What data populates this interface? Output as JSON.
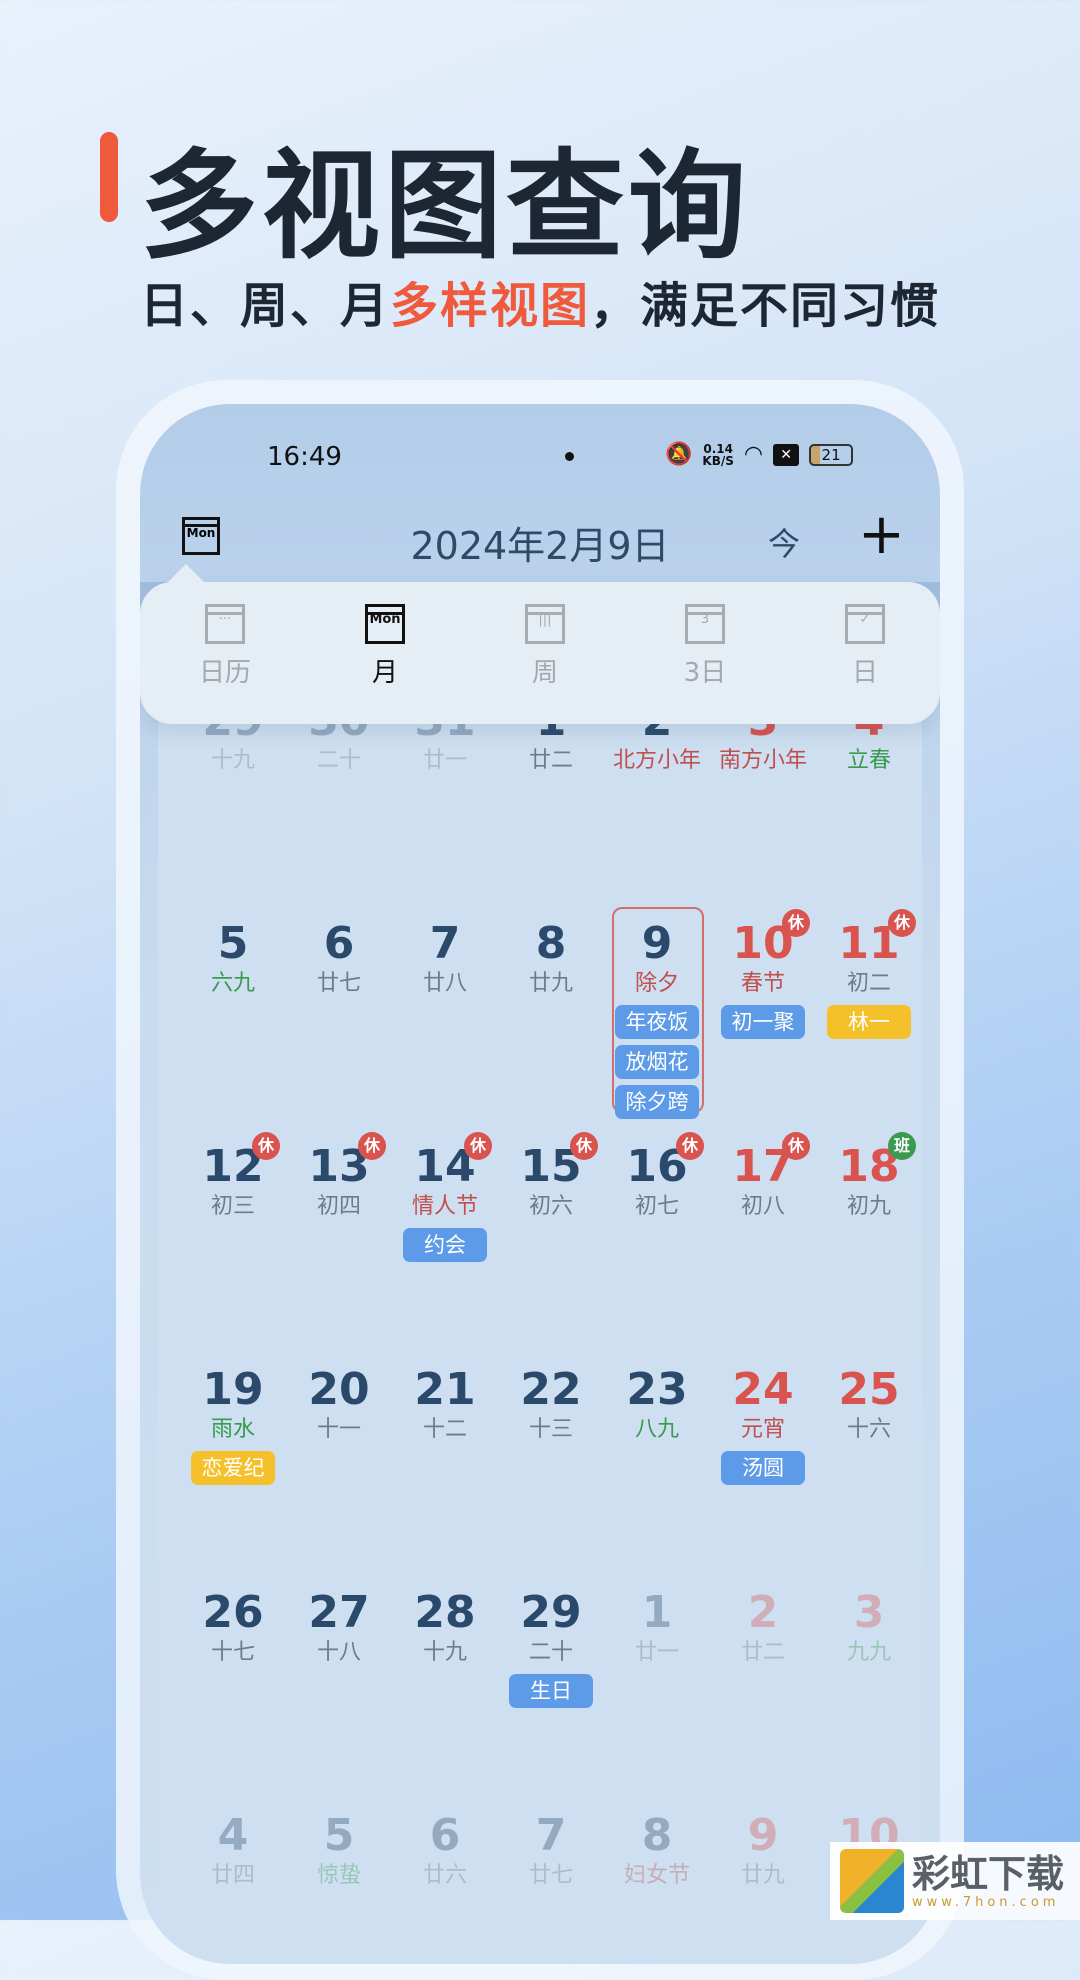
{
  "promo": {
    "title": "多视图查询",
    "subtitle_pre": "日、周、月",
    "subtitle_highlight": "多样视图",
    "subtitle_post": "，满足不同习惯",
    "accent": "#ef5a3c"
  },
  "status_bar": {
    "time": "16:49",
    "net_speed": "0.14",
    "net_unit": "KB/S",
    "battery": "21",
    "icons": [
      "mute-bell-icon",
      "wifi-icon",
      "x-box-icon",
      "battery-icon"
    ]
  },
  "header": {
    "view_icon_label": "Mon",
    "date": "2024年2月9日",
    "today": "今",
    "add": "+"
  },
  "view_menu": [
    {
      "label": "日历",
      "icon": "grid-calendar-icon",
      "glyph": "···"
    },
    {
      "label": "月",
      "icon": "month-calendar-icon",
      "glyph": "Mon",
      "active": true
    },
    {
      "label": "周",
      "icon": "week-calendar-icon",
      "glyph": "|||"
    },
    {
      "label": "3日",
      "icon": "three-day-calendar-icon",
      "glyph": "3"
    },
    {
      "label": "日",
      "icon": "day-calendar-icon",
      "glyph": "✓"
    }
  ],
  "calendar": {
    "rows": [
      [
        {
          "d": "29",
          "l": "十九",
          "dim": true
        },
        {
          "d": "30",
          "l": "二十",
          "dim": true
        },
        {
          "d": "31",
          "l": "廿一",
          "dim": true
        },
        {
          "d": "1",
          "l": "廿二"
        },
        {
          "d": "2",
          "l": "北方小年",
          "lc": "r"
        },
        {
          "d": "3",
          "l": "南方小年",
          "lc": "r",
          "red": true
        },
        {
          "d": "4",
          "l": "立春",
          "lc": "g",
          "red": true
        }
      ],
      [
        {
          "d": "5",
          "l": "六九",
          "lc": "g"
        },
        {
          "d": "6",
          "l": "廿七"
        },
        {
          "d": "7",
          "l": "廿八"
        },
        {
          "d": "8",
          "l": "廿九"
        },
        {
          "d": "9",
          "l": "除夕",
          "lc": "r",
          "selected": true,
          "ev": [
            "年夜饭",
            "放烟花",
            "除夕跨"
          ]
        },
        {
          "d": "10",
          "l": "春节",
          "lc": "r",
          "red": true,
          "badge": "休",
          "ev": [
            "初一聚"
          ]
        },
        {
          "d": "11",
          "l": "初二",
          "red": true,
          "badge": "休",
          "ev": [
            "林一"
          ],
          "evy": true
        }
      ],
      [
        {
          "d": "12",
          "l": "初三",
          "badge": "休"
        },
        {
          "d": "13",
          "l": "初四",
          "badge": "休"
        },
        {
          "d": "14",
          "l": "情人节",
          "lc": "r",
          "badge": "休",
          "ev": [
            "约会"
          ]
        },
        {
          "d": "15",
          "l": "初六",
          "badge": "休"
        },
        {
          "d": "16",
          "l": "初七",
          "badge": "休"
        },
        {
          "d": "17",
          "l": "初八",
          "red": true,
          "badge": "休"
        },
        {
          "d": "18",
          "l": "初九",
          "red": true,
          "badge": "班",
          "work": true
        }
      ],
      [
        {
          "d": "19",
          "l": "雨水",
          "lc": "g",
          "ev": [
            "恋爱纪"
          ],
          "evy": true
        },
        {
          "d": "20",
          "l": "十一"
        },
        {
          "d": "21",
          "l": "十二"
        },
        {
          "d": "22",
          "l": "十三"
        },
        {
          "d": "23",
          "l": "八九",
          "lc": "g"
        },
        {
          "d": "24",
          "l": "元宵",
          "lc": "r",
          "red": true,
          "ev": [
            "汤圆"
          ]
        },
        {
          "d": "25",
          "l": "十六",
          "red": true
        }
      ],
      [
        {
          "d": "26",
          "l": "十七"
        },
        {
          "d": "27",
          "l": "十八"
        },
        {
          "d": "28",
          "l": "十九"
        },
        {
          "d": "29",
          "l": "二十",
          "ev": [
            "生日"
          ]
        },
        {
          "d": "1",
          "l": "廿一",
          "dim": true
        },
        {
          "d": "2",
          "l": "廿二",
          "dim": true,
          "red": true
        },
        {
          "d": "3",
          "l": "九九",
          "lc": "g",
          "dim": true,
          "red": true
        }
      ],
      [
        {
          "d": "4",
          "l": "廿四",
          "dim": true
        },
        {
          "d": "5",
          "l": "惊蛰",
          "lc": "g",
          "dim": true
        },
        {
          "d": "6",
          "l": "廿六",
          "dim": true
        },
        {
          "d": "7",
          "l": "廿七",
          "dim": true
        },
        {
          "d": "8",
          "l": "妇女节",
          "lc": "r",
          "dim": true
        },
        {
          "d": "9",
          "l": "廿九",
          "dim": true,
          "red": true
        },
        {
          "d": "10",
          "l": "",
          "dim": true,
          "red": true
        }
      ]
    ]
  },
  "colors": {
    "number": "#2b4a6b",
    "holiday_red": "#d9534f",
    "term_green": "#3a9a50",
    "event_blue": "#5d9be8",
    "event_yellow": "#f5c12a"
  },
  "watermark": {
    "name": "彩虹下载",
    "url": "www.7hon.com"
  }
}
